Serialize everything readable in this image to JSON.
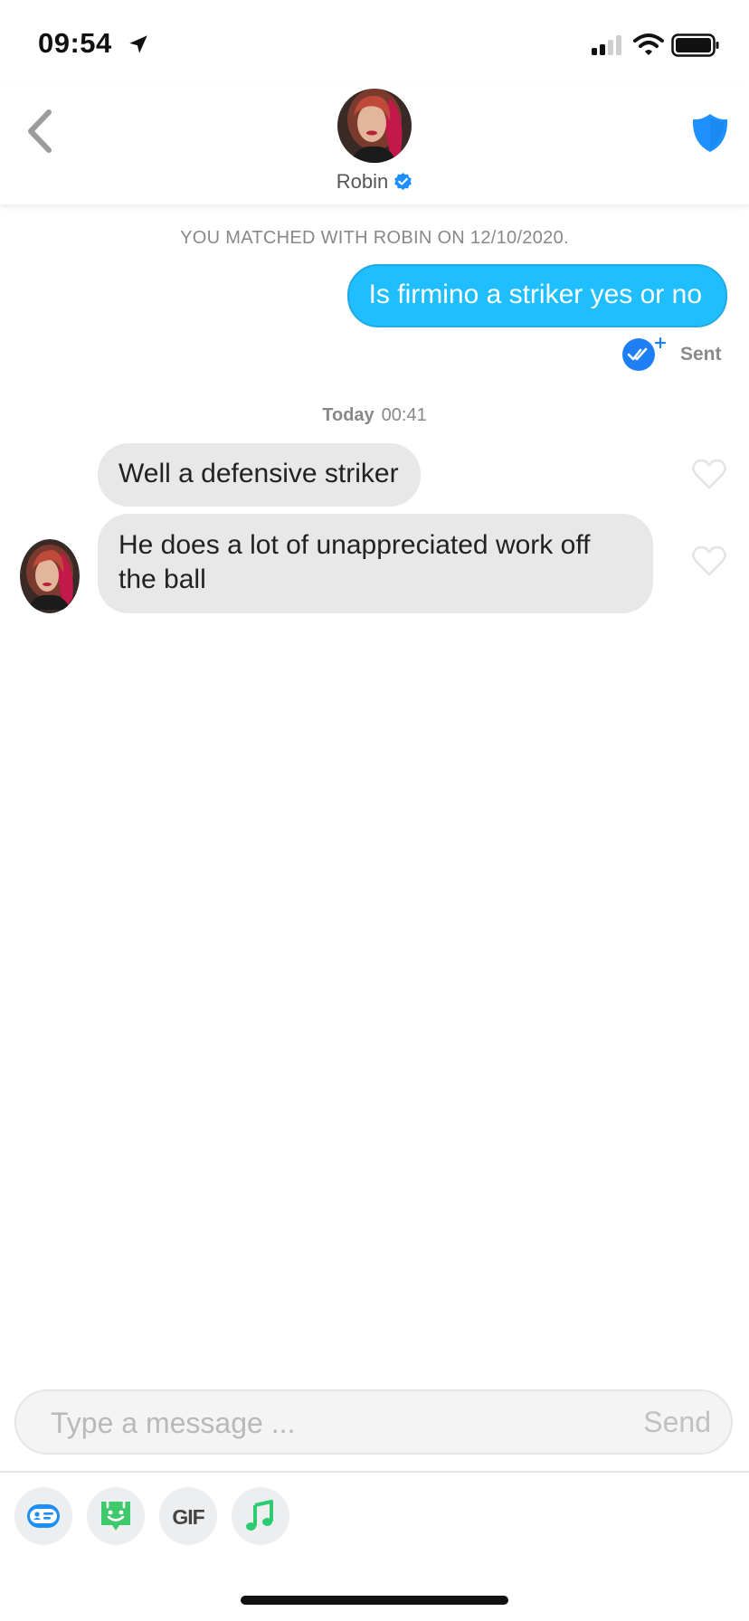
{
  "status_bar": {
    "time": "09:54"
  },
  "header": {
    "name": "Robin"
  },
  "conversation": {
    "match_note": "YOU MATCHED WITH ROBIN ON 12/10/2020.",
    "outgoing": {
      "text": "Is firmino a striker yes or no",
      "status": "Sent"
    },
    "time_divider": {
      "day": "Today",
      "time": "00:41"
    },
    "incoming": [
      {
        "text": "Well a defensive striker"
      },
      {
        "text": "He does a lot of unappreciated work off the ball"
      }
    ]
  },
  "composer": {
    "placeholder": "Type a message ...",
    "send_label": "Send"
  },
  "toolbar": {
    "gif_label": "GIF"
  },
  "colors": {
    "accent_blue": "#1ebeff",
    "verified_blue": "#1d8fff",
    "shield_blue": "#1e90ff",
    "incoming_bubble": "#e8e8e8",
    "sticker_green": "#3ec96a",
    "music_green": "#2ecc71"
  },
  "icons": {
    "back": "chevron-left-icon",
    "verified": "verified-badge-icon",
    "safety": "shield-icon",
    "read": "double-check-icon",
    "like": "heart-icon",
    "card": "id-card-icon",
    "sticker": "sticker-icon",
    "music": "music-note-icon"
  }
}
